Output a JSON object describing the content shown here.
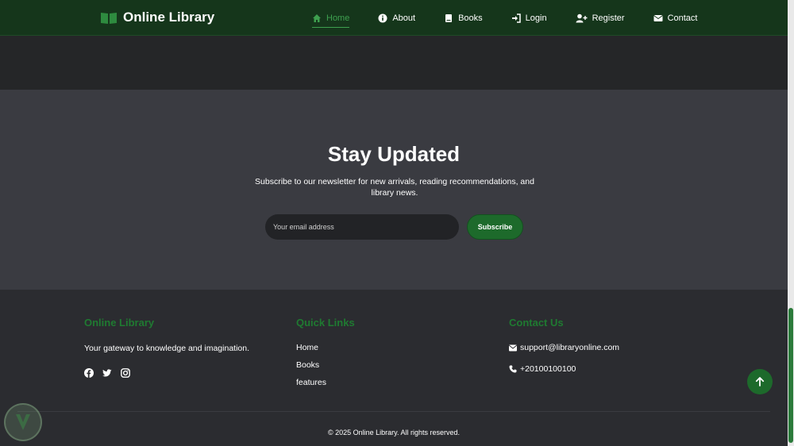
{
  "navbar": {
    "brand": "Online Library",
    "items": [
      {
        "label": "Home",
        "icon": "home-icon",
        "active": true
      },
      {
        "label": "About",
        "icon": "info-icon"
      },
      {
        "label": "Books",
        "icon": "book-icon"
      },
      {
        "label": "Login",
        "icon": "login-icon"
      },
      {
        "label": "Register",
        "icon": "user-plus-icon"
      },
      {
        "label": "Contact",
        "icon": "envelope-icon"
      }
    ]
  },
  "newsletter": {
    "title": "Stay Updated",
    "subtitle": "Subscribe to our newsletter for new arrivals, reading recommendations, and library news.",
    "email_placeholder": "Your email address",
    "subscribe_label": "Subscribe"
  },
  "footer": {
    "about": {
      "heading": "Online Library",
      "text": "Your gateway to knowledge and imagination."
    },
    "quick_links": {
      "heading": "Quick Links",
      "links": [
        "Home",
        "Books",
        "features"
      ]
    },
    "contact": {
      "heading": "Contact Us",
      "email": "support@libraryonline.com",
      "phone": "+20100100100"
    },
    "copyright": "© 2025 Online Library. All rights reserved."
  },
  "colors": {
    "accent": "#1d6a2b",
    "nav_bg": "#15361b",
    "newsletter_bg": "#3a3b41",
    "footer_bg": "#2b2c30"
  }
}
